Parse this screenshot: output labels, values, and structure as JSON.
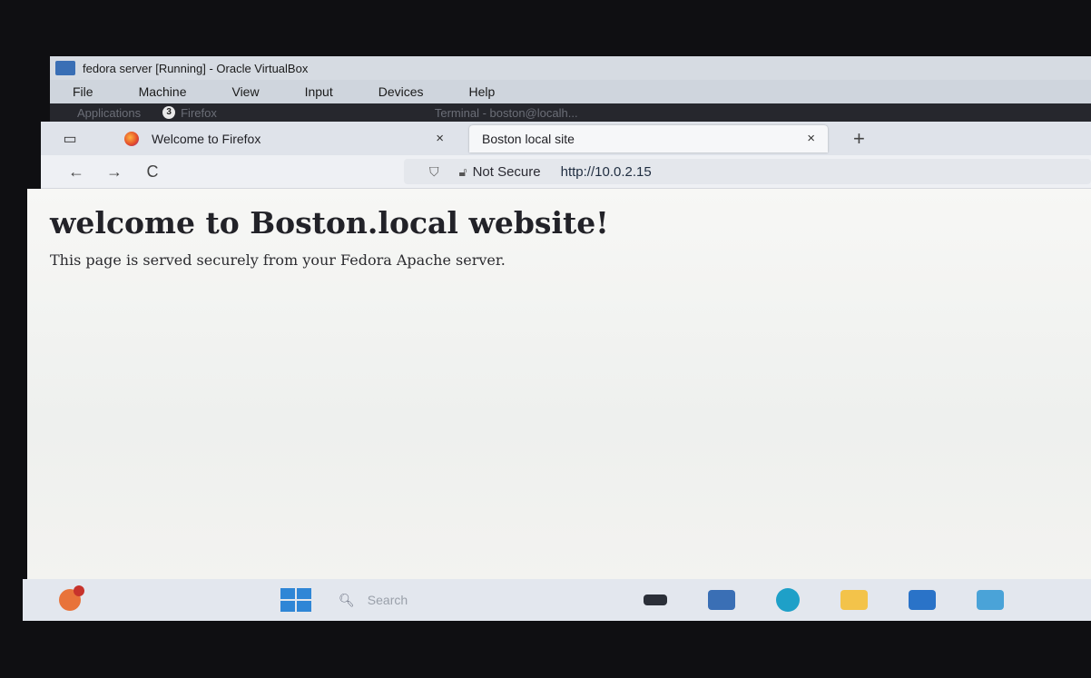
{
  "vbox": {
    "title": "fedora server [Running] - Oracle VirtualBox",
    "menu": [
      "File",
      "Machine",
      "View",
      "Input",
      "Devices",
      "Help"
    ]
  },
  "guest_panel": {
    "applications": "Applications",
    "badge_count": "3",
    "firefox": "Firefox",
    "terminal": "Terminal - boston@localh..."
  },
  "browser": {
    "tabs": [
      {
        "label": "Welcome to Firefox",
        "close": "×",
        "icon": "firefox-icon"
      },
      {
        "label": "Boston local site",
        "close": "×"
      }
    ],
    "new_tab": "+",
    "nav": {
      "back": "←",
      "forward": "→",
      "reload": "C"
    },
    "urlbar": {
      "security_text": "Not Secure",
      "url": "http://10.0.2.15"
    }
  },
  "page": {
    "heading": "welcome to Boston.local website!",
    "body": "This page is served securely from your Fedora Apache server."
  },
  "taskbar": {
    "search_placeholder": "Search"
  }
}
